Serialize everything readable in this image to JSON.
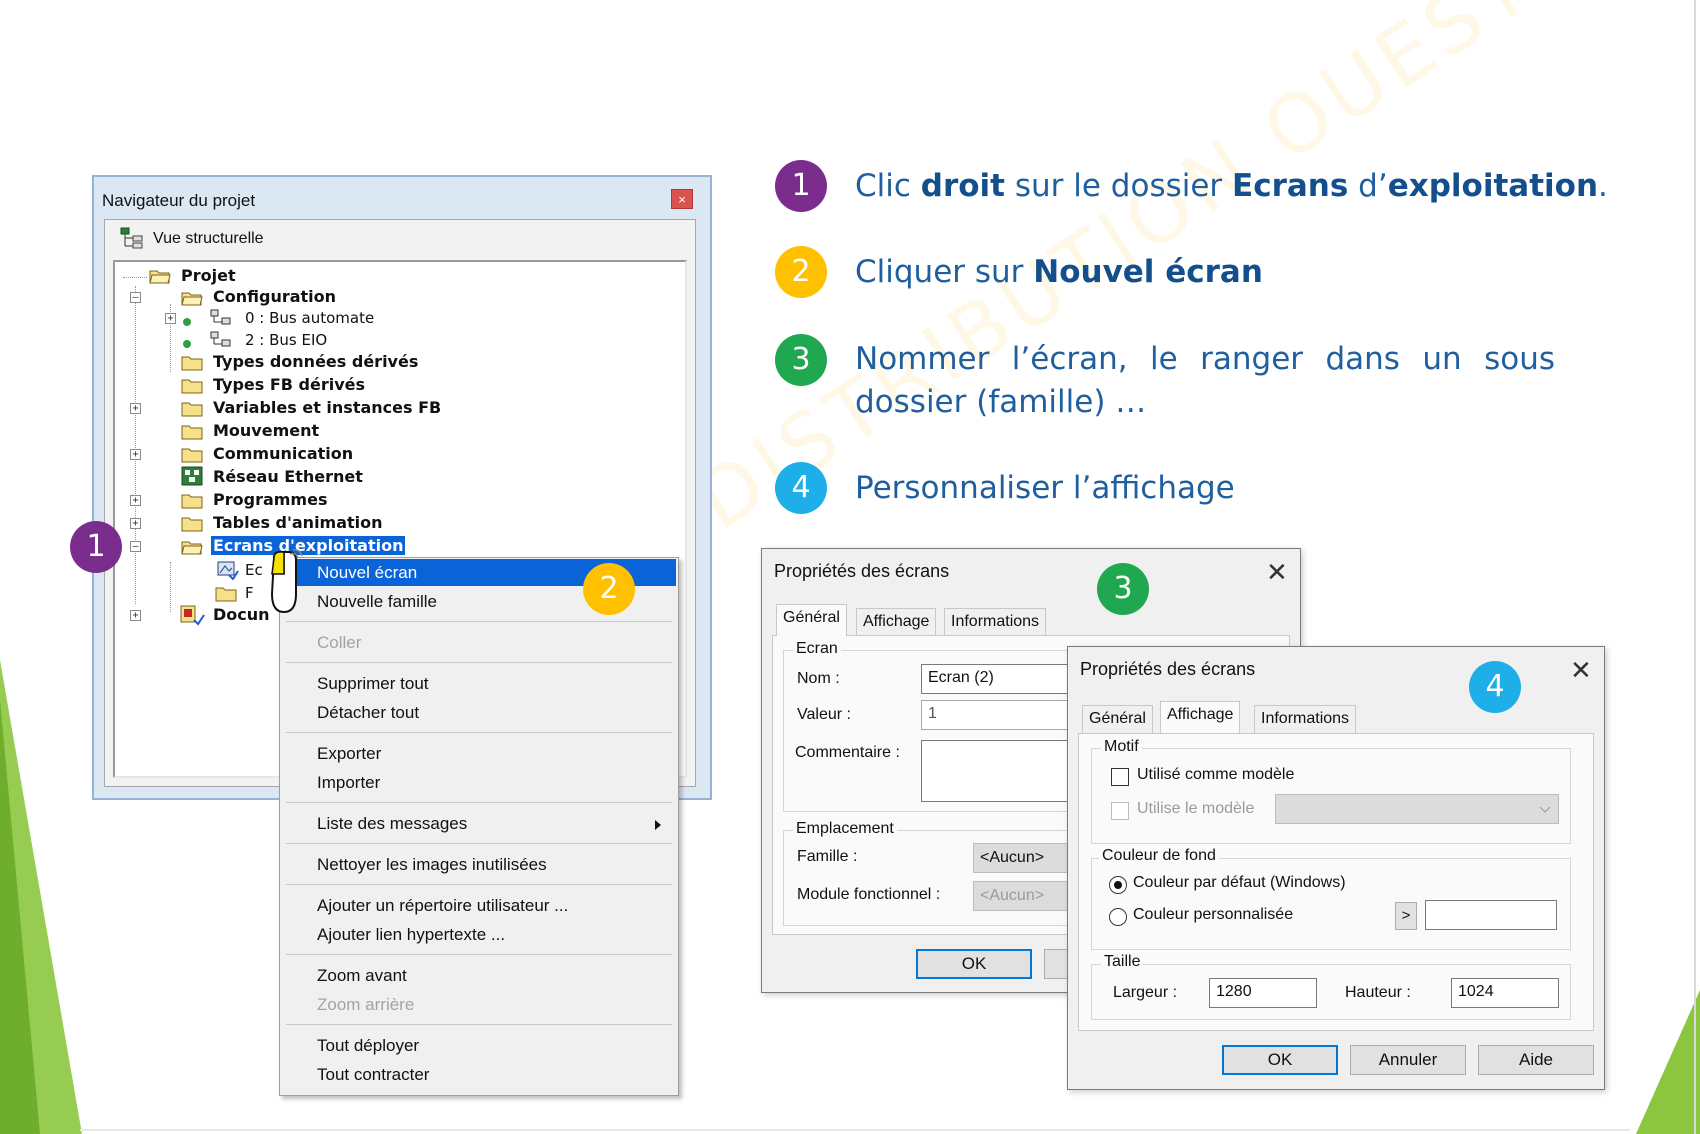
{
  "navigator": {
    "title": "Navigateur du projet",
    "close_glyph": "×",
    "view_label": "Vue structurelle",
    "tree": {
      "projet": "Projet",
      "configuration": "Configuration",
      "bus_automate": "0 : Bus automate",
      "bus_eio": "2 : Bus EIO",
      "types_donnees": "Types données dérivés",
      "types_fb": "Types FB dérivés",
      "variables": "Variables et instances FB",
      "mouvement": "Mouvement",
      "communication": "Communication",
      "reseau": "Réseau Ethernet",
      "programmes": "Programmes",
      "tables": "Tables d'animation",
      "ecrans": "Ecrans d'exploitation",
      "ecr_child_1": "Ec",
      "ecr_child_2": "F",
      "documentation": "Docun"
    }
  },
  "context_menu": {
    "nouvel_ecran": "Nouvel écran",
    "nouvelle_famille": "Nouvelle famille",
    "coller": "Coller",
    "supprimer_tout": "Supprimer tout",
    "detacher_tout": "Détacher tout",
    "exporter": "Exporter",
    "importer": "Importer",
    "liste_messages": "Liste des messages",
    "nettoyer": "Nettoyer les images inutilisées",
    "ajouter_repertoire": "Ajouter un répertoire utilisateur ...",
    "ajouter_lien": "Ajouter lien hypertexte ...",
    "zoom_avant": "Zoom avant",
    "zoom_arriere": "Zoom arrière",
    "tout_deployer": "Tout déployer",
    "tout_contracter": "Tout contracter"
  },
  "badges": {
    "b1": "1",
    "b2": "2",
    "b3": "3",
    "b4": "4"
  },
  "instructions": {
    "step1": {
      "a": "Clic ",
      "b": "droit",
      "c": " sur le dossier ",
      "d": "Ecrans",
      "e": " d’",
      "f": "exploitation",
      "g": "."
    },
    "step2": {
      "a": "Cliquer sur ",
      "b": "Nouvel écran"
    },
    "step3": "Nommer l’écran, le ranger dans un sous dossier (famille) …",
    "step4": "Personnaliser l’affichage"
  },
  "watermark": "DISTRIBUTION OUEST",
  "dialog_general": {
    "title": "Propriétés des écrans",
    "close_glyph": "✕",
    "tabs": [
      "Général",
      "Affichage",
      "Informations"
    ],
    "group_ecran": "Ecran",
    "nom_label": "Nom :",
    "nom_value": "Ecran (2)",
    "valeur_label": "Valeur :",
    "valeur_value": "1",
    "commentaire_label": "Commentaire :",
    "group_emplacement": "Emplacement",
    "famille_label": "Famille :",
    "famille_value": "<Aucun>",
    "module_label": "Module fonctionnel :",
    "module_value": "<Aucun>",
    "ok": "OK"
  },
  "dialog_affichage": {
    "title": "Propriétés des écrans",
    "close_glyph": "✕",
    "tabs": [
      "Général",
      "Affichage",
      "Informations"
    ],
    "group_motif": "Motif",
    "utilise_comme_modele": "Utilisé comme modèle",
    "utilise_le_modele": "Utilise le modèle",
    "group_couleur": "Couleur de fond",
    "couleur_defaut": "Couleur par défaut (Windows)",
    "couleur_perso": "Couleur personnalisée",
    "pick_btn": ">",
    "group_taille": "Taille",
    "largeur_label": "Largeur :",
    "largeur_value": "1280",
    "hauteur_label": "Hauteur :",
    "hauteur_value": "1024",
    "ok": "OK",
    "annuler": "Annuler",
    "aide": "Aide"
  },
  "colors": {
    "purple": "#7b2d8e",
    "yellow": "#ffc000",
    "green": "#1fa84f",
    "cyan": "#1eaee8",
    "text_blue": "#1f5f9f",
    "selection": "#0a64d8",
    "deco_green": "#8cc63f"
  }
}
